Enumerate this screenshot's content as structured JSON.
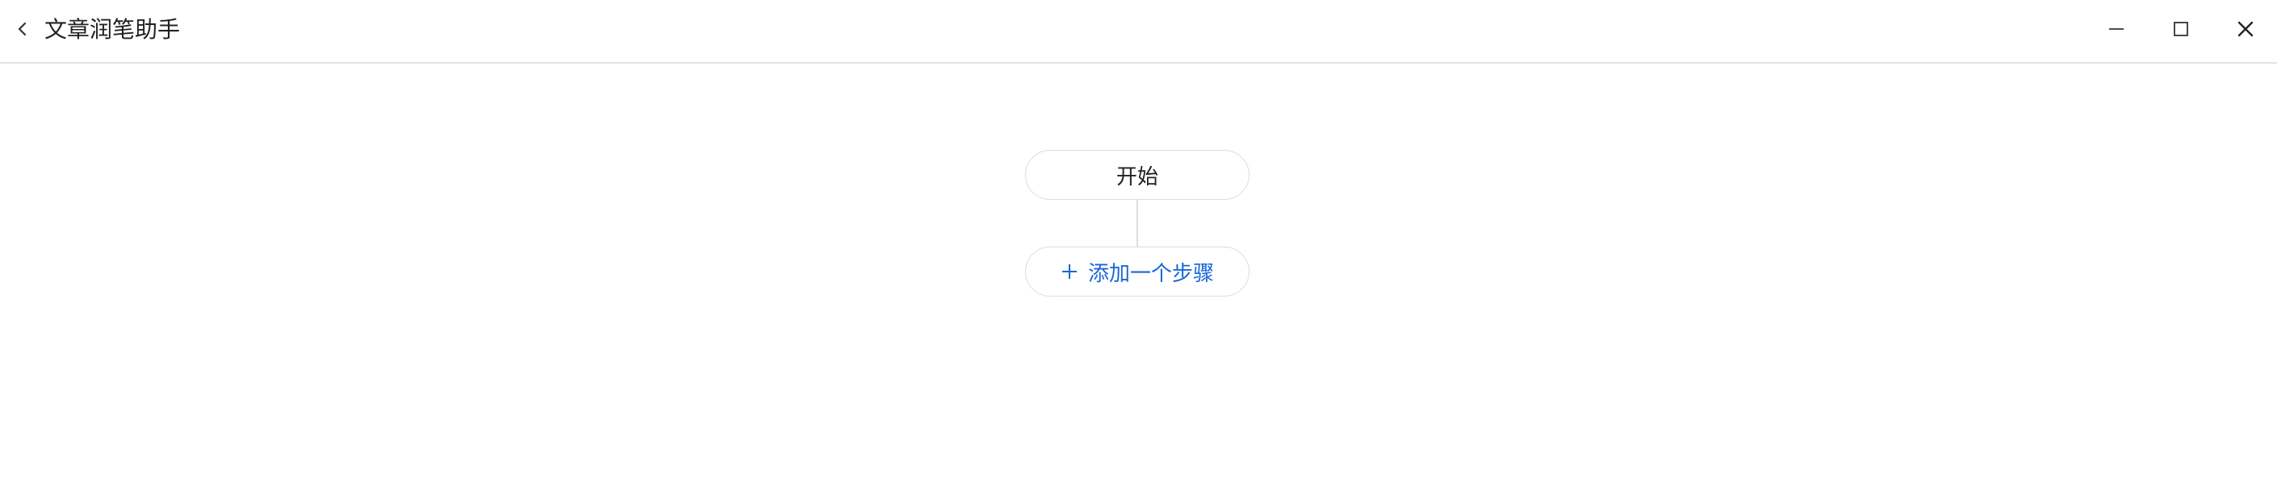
{
  "window": {
    "title": "文章润笔助手"
  },
  "icons": {
    "back": "chevron-left-icon",
    "minimize": "minimize-icon",
    "maximize": "maximize-icon",
    "close": "close-icon",
    "add": "plus-icon"
  },
  "colors": {
    "accent": "#1a66d9",
    "border": "#dcdcdc",
    "text": "#222222"
  },
  "flow": {
    "start_label": "开始",
    "add_step_label": "添加一个步骤"
  }
}
